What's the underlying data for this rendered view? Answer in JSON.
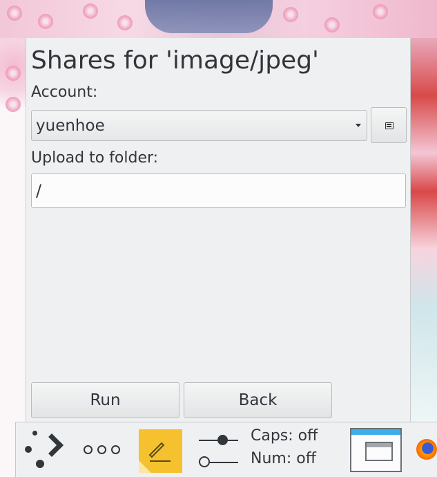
{
  "dialog": {
    "title": "Shares for 'image/jpeg'",
    "account_label": "Account:",
    "account_value": "yuenhoe",
    "folder_label": "Upload to folder:",
    "folder_value": "/",
    "run_label": "Run",
    "back_label": "Back"
  },
  "panel": {
    "launcher_icon": "application-launcher-icon",
    "more_icon": "more-dots-icon",
    "notes_icon": "sticky-note-icon",
    "caps_label": "Caps: off",
    "num_label": "Num: off",
    "window_icon": "show-desktop-icon",
    "browser_icon": "firefox-icon"
  },
  "colors": {
    "window_bg": "#eff0f1",
    "text": "#31363b",
    "accent": "#3daee9",
    "note": "#f5c12e"
  }
}
